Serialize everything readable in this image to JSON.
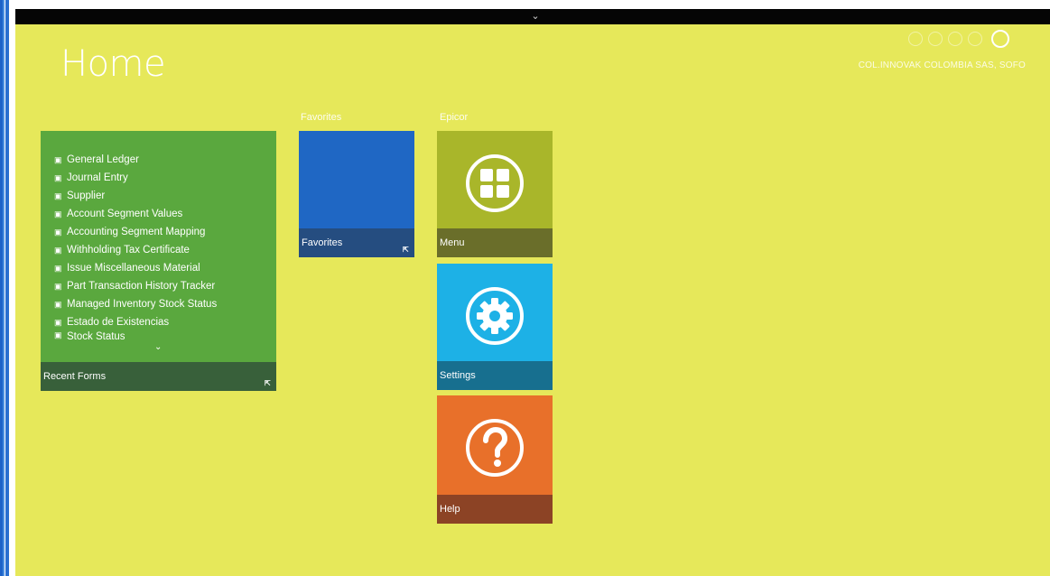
{
  "header": {
    "title": "Home",
    "company": "COL.INNOVAK COLOMBIA SAS, SOFO",
    "topbar_chevron_icon": "chevron-down-icon",
    "icons": [
      "header-icon-1",
      "header-icon-2",
      "header-icon-3",
      "header-icon-4",
      "search-icon"
    ]
  },
  "sections": {
    "favorites_label": "Favorites",
    "epicor_label": "Epicor"
  },
  "recent_forms": {
    "items": [
      {
        "label": "General Ledger"
      },
      {
        "label": "Journal Entry"
      },
      {
        "label": "Supplier"
      },
      {
        "label": "Account Segment Values"
      },
      {
        "label": "Accounting Segment Mapping"
      },
      {
        "label": "Withholding Tax Certificate"
      },
      {
        "label": "Issue Miscellaneous Material"
      },
      {
        "label": "Part Transaction History Tracker"
      },
      {
        "label": "Managed Inventory Stock Status"
      },
      {
        "label": "Estado de Existencias"
      },
      {
        "label": "Stock Status"
      }
    ],
    "footer_label": "Recent Forms"
  },
  "tiles": {
    "favorites": {
      "label": "Favorites"
    },
    "menu": {
      "label": "Menu"
    },
    "settings": {
      "label": "Settings"
    },
    "help": {
      "label": "Help"
    }
  },
  "colors": {
    "background": "#e6e85a",
    "recent_forms": "#5aa83e",
    "favorites": "#1f67c4",
    "menu": "#a9b62a",
    "settings": "#1db1e6",
    "help": "#e8702a"
  }
}
